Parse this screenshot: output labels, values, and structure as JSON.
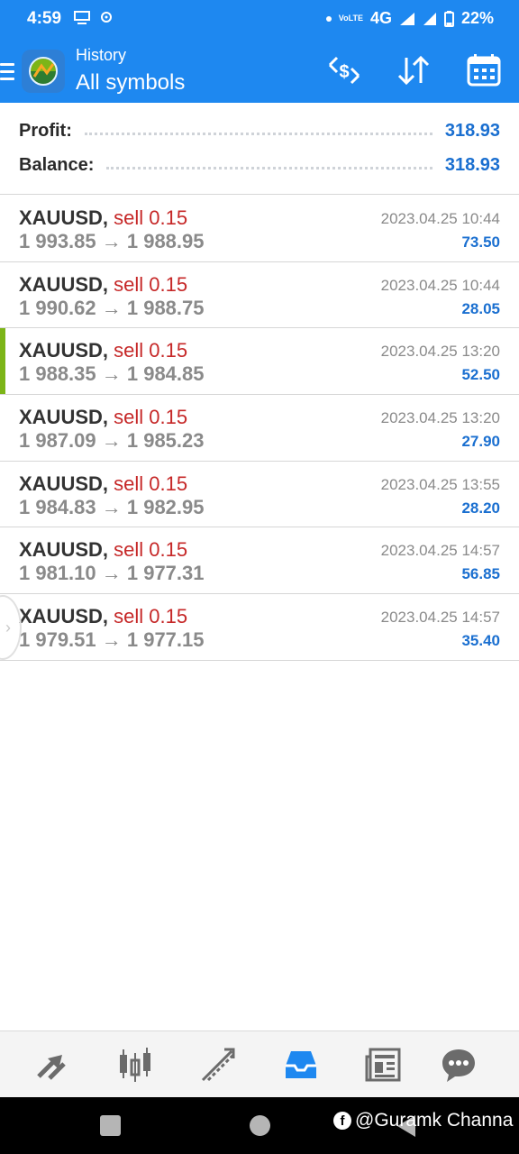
{
  "status_bar": {
    "time": "4:59",
    "battery": "22%",
    "network": "4G"
  },
  "app_bar": {
    "title": "History",
    "subtitle": "All symbols"
  },
  "summary": {
    "profit_label": "Profit:",
    "profit_value": "318.93",
    "balance_label": "Balance:",
    "balance_value": "318.93"
  },
  "deals": [
    {
      "symbol": "XAUUSD,",
      "side": "sell 0.15",
      "prices": "1 993.85 → 1 988.95",
      "time": "2023.04.25 10:44",
      "profit": "73.50"
    },
    {
      "symbol": "XAUUSD,",
      "side": "sell 0.15",
      "prices": "1 990.62 → 1 988.75",
      "time": "2023.04.25 10:44",
      "profit": "28.05"
    },
    {
      "symbol": "XAUUSD,",
      "side": "sell 0.15",
      "prices": "1 988.35 → 1 984.85",
      "time": "2023.04.25 13:20",
      "profit": "52.50"
    },
    {
      "symbol": "XAUUSD,",
      "side": "sell 0.15",
      "prices": "1 987.09 → 1 985.23",
      "time": "2023.04.25 13:20",
      "profit": "27.90"
    },
    {
      "symbol": "XAUUSD,",
      "side": "sell 0.15",
      "prices": "1 984.83 → 1 982.95",
      "time": "2023.04.25 13:55",
      "profit": "28.20"
    },
    {
      "symbol": "XAUUSD,",
      "side": "sell 0.15",
      "prices": "1 981.10 → 1 977.31",
      "time": "2023.04.25 14:57",
      "profit": "56.85"
    },
    {
      "symbol": "XAUUSD,",
      "side": "sell 0.15",
      "prices": "1 979.51 → 1 977.15",
      "time": "2023.04.25 14:57",
      "profit": "35.40"
    }
  ],
  "watermark": {
    "text": "@Guramk Channa"
  },
  "colors": {
    "accent": "#1e88f0",
    "sell": "#c62828",
    "profit": "#1a6fd0",
    "marker": "#7cb518"
  }
}
